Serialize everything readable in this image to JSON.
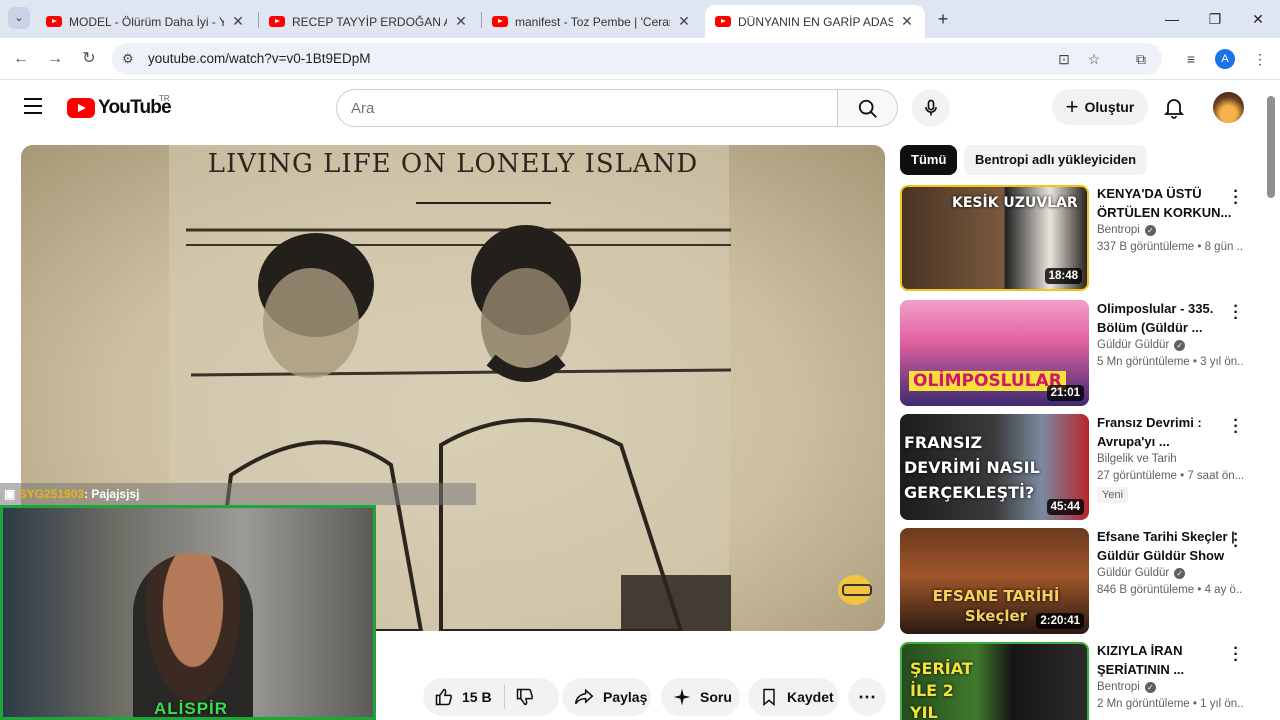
{
  "browser": {
    "tabs": [
      {
        "title": "MODEL - Ölürüm Daha İyi - You"
      },
      {
        "title": "RECEP TAYYİP ERDOĞAN ARAP"
      },
      {
        "title": "manifest - Toz Pembe | 'Cerami"
      },
      {
        "title": "DÜNYANIN EN GARİP ADASINI"
      }
    ],
    "url": "youtube.com/watch?v=v0-1Bt9EDpM",
    "profile_initial": "A"
  },
  "youtube": {
    "logo_text": "YouTube",
    "country_code": "TR",
    "search_placeholder": "Ara",
    "create_label": "Oluştur"
  },
  "video": {
    "frame_title": "LIVING LIFE ON LONELY ISLAND"
  },
  "stream_overlay": {
    "chat_user": "SYG251903",
    "chat_message": ": Pajajsjsj",
    "streamer_name": "ALİSPİR"
  },
  "actions": {
    "like_count": "15 B",
    "share_label": "Paylaş",
    "ask_label": "Soru",
    "save_label": "Kaydet"
  },
  "filters": {
    "chips": [
      "Tümü",
      "Bentropi adlı yükleyiciden"
    ],
    "active_index": 0
  },
  "recommendations": [
    {
      "title": "KENYA'DA ÜSTÜ ÖRTÜLEN KORKUN...",
      "channel": "Bentropi",
      "verified": true,
      "meta": "337 B görüntüleme • 8 gün ...",
      "duration": "18:48",
      "thumb_text": "KESİK UZUVLAR",
      "badge": ""
    },
    {
      "title": "Olimposlular - 335. Bölüm (Güldür ...",
      "channel": "Güldür Güldür",
      "verified": true,
      "meta": "5 Mn görüntüleme • 3 yıl ön...",
      "duration": "21:01",
      "thumb_text": "OLİMPOSLULAR",
      "badge": ""
    },
    {
      "title": "Fransız Devrimi : Avrupa'yı ...",
      "channel": "Bilgelik ve Tarih",
      "verified": false,
      "meta": "27 görüntüleme • 7 saat ön...",
      "duration": "45:44",
      "thumb_text": "FRANSIZ DEVRİMİ NASIL GERÇEKLEŞTİ?",
      "badge": "Yeni"
    },
    {
      "title": "Efsane Tarihi Skeçler | Güldür Güldür Show",
      "channel": "Güldür Güldür",
      "verified": true,
      "meta": "846 B görüntüleme • 4 ay ö...",
      "duration": "2:20:41",
      "thumb_text": "EFSANE TARİHİ Skeçler",
      "badge": ""
    },
    {
      "title": "KIZIYLA İRAN ŞERİATININ ...",
      "channel": "Bentropi",
      "verified": true,
      "meta": "2 Mn görüntüleme • 1 yıl ön...",
      "duration": "",
      "thumb_text": "ŞERİAT İLE 2 YIL",
      "badge": ""
    }
  ],
  "colors": {
    "youtube_red": "#ff0000",
    "stream_green": "#38e04f",
    "chat_user": "#e8b21d"
  }
}
